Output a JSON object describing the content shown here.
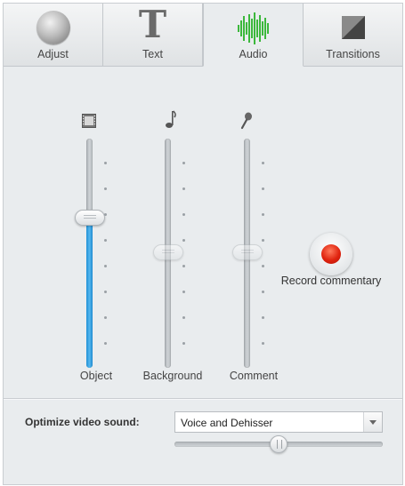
{
  "tabs": [
    {
      "label": "Adjust",
      "icon": "sphere-icon",
      "active": false
    },
    {
      "label": "Text",
      "icon": "text-t-icon",
      "active": false
    },
    {
      "label": "Audio",
      "icon": "audio-waveform-icon",
      "active": true
    },
    {
      "label": "Transitions",
      "icon": "transition-icon",
      "active": false
    }
  ],
  "mixer": {
    "sliders": [
      {
        "label": "Object",
        "icon": "film-strip-icon",
        "level": 0.66,
        "enabled": true
      },
      {
        "label": "Background",
        "icon": "music-note-icon",
        "level": 0.5,
        "enabled": false
      },
      {
        "label": "Comment",
        "icon": "microphone-icon",
        "level": 0.5,
        "enabled": false
      }
    ],
    "record": {
      "label": "Record commentary"
    }
  },
  "optimize": {
    "label": "Optimize video sound:",
    "selected": "Voice and Dehisser",
    "level": 0.5
  },
  "colors": {
    "accent_blue": "#3aa6e6",
    "record_red": "#e0240f",
    "audio_green": "#3cb83c",
    "panel_bg": "#e9ecee"
  }
}
